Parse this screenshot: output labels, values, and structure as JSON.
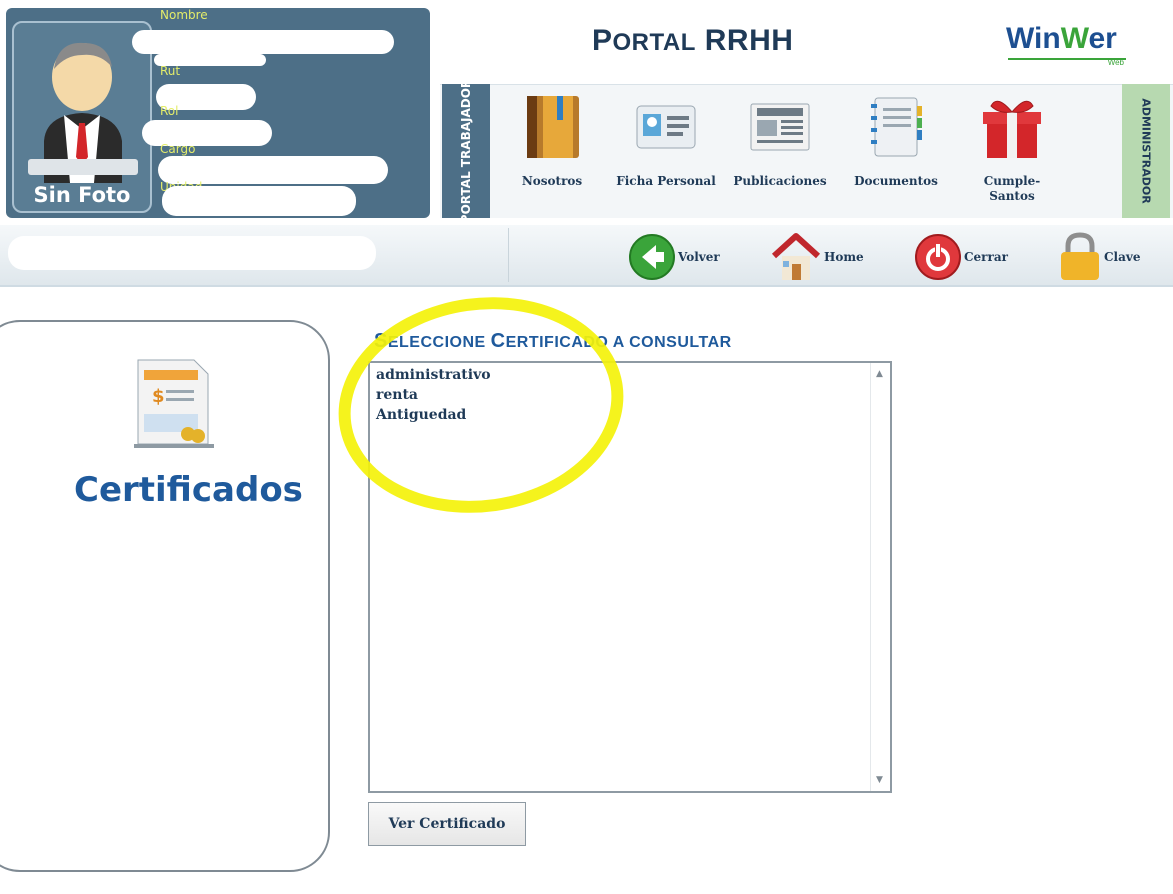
{
  "profile": {
    "photo_label": "Sin Foto",
    "fields": [
      "Nombre",
      "Rut",
      "Rol",
      "Cargo",
      "Unidad"
    ]
  },
  "header": {
    "title_first": "P",
    "title_rest": "ORTAL",
    "title_end": "RRHH",
    "logo_main": "Win",
    "logo_w": "W",
    "logo_end": "er",
    "logo_sub": "Web"
  },
  "modules": {
    "left_tab": "PORTAL TRABAJADOR",
    "right_tab": "ADMINISTRADOR",
    "items": [
      {
        "label": "Nosotros",
        "icon": "book-icon"
      },
      {
        "label": "Ficha Personal",
        "icon": "id-card-icon"
      },
      {
        "label": "Publicaciones",
        "icon": "newspaper-icon"
      },
      {
        "label": "Documentos",
        "icon": "binder-icon"
      },
      {
        "label": "Cumple-Santos",
        "icon": "gift-icon"
      }
    ]
  },
  "actions": {
    "back": "Volver",
    "home": "Home",
    "close": "Cerrar",
    "password": "Clave"
  },
  "left_panel": {
    "title": "Certificados"
  },
  "main": {
    "title_s": "S",
    "title_mid": "ELECCIONE ",
    "title_c": "C",
    "title_rest": "ERTIFICADO A CONSULTAR",
    "options": [
      "administrativo",
      "renta",
      "Antiguedad"
    ],
    "button": "Ver Certificado"
  },
  "colors": {
    "header_blue": "#4d6f87",
    "title_blue": "#1f5a9c",
    "highlight_yellow": "#f4f20a",
    "field_label": "#e4ed6a"
  }
}
